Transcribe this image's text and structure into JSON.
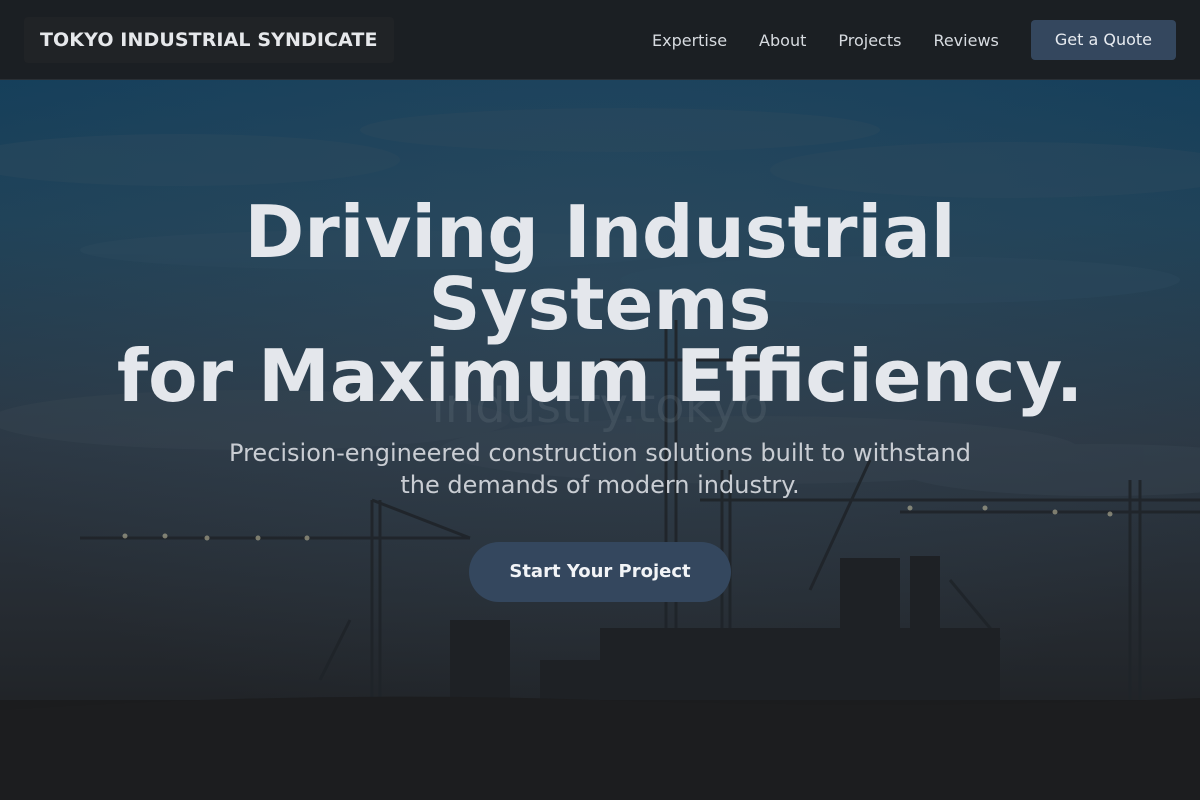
{
  "header": {
    "logo_text": "TOKYO INDUSTRIAL SYNDICATE",
    "nav": [
      {
        "label": "Expertise"
      },
      {
        "label": "About"
      },
      {
        "label": "Projects"
      },
      {
        "label": "Reviews"
      }
    ],
    "cta_label": "Get a Quote"
  },
  "hero": {
    "title_lines": [
      "Driving Industrial",
      "Systems",
      "for Maximum Efficiency."
    ],
    "watermark": "industry.tokyo",
    "subtitle_lines": [
      "Precision-engineered construction solutions built to withstand",
      "the demands of modern industry."
    ],
    "cta_label": "Start Your Project",
    "background_image": "construction-cranes-dusk-silhouette"
  },
  "colors": {
    "header_bg": "#1b1f23",
    "accent": "#34475e",
    "text_primary": "#e4e7ec",
    "text_secondary": "#c9cdd3",
    "page_bg": "#1b1c1e"
  }
}
